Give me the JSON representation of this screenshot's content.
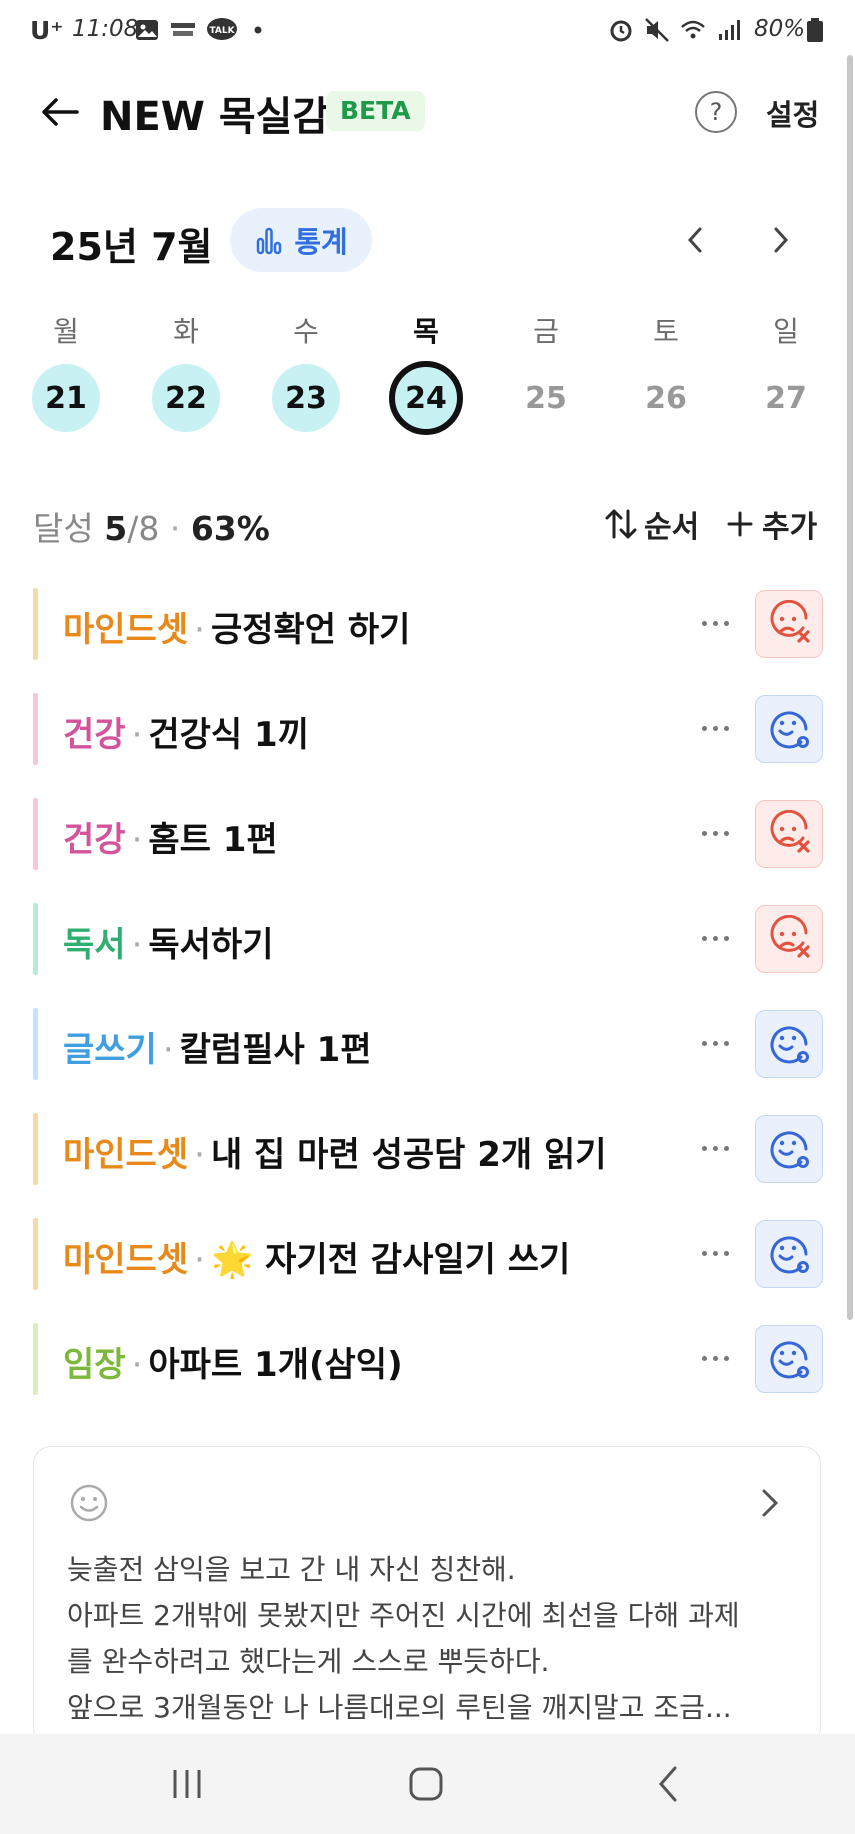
{
  "status_bar": {
    "carrier": "U⁺",
    "time": "11:08",
    "battery": "80%"
  },
  "header": {
    "title": "NEW 목실감",
    "badge": "BETA",
    "help_label": "?",
    "settings_label": "설정"
  },
  "calendar": {
    "month": "25년 7월",
    "stats_label": "통계",
    "weekdays": [
      "월",
      "화",
      "수",
      "목",
      "금",
      "토",
      "일"
    ],
    "days": [
      {
        "num": "21",
        "state": "done"
      },
      {
        "num": "22",
        "state": "done"
      },
      {
        "num": "23",
        "state": "done"
      },
      {
        "num": "24",
        "state": "selected"
      },
      {
        "num": "25",
        "state": "future"
      },
      {
        "num": "26",
        "state": "future"
      },
      {
        "num": "27",
        "state": "future"
      }
    ]
  },
  "summary": {
    "label": "달성",
    "done": "5",
    "total": "/8",
    "dot": "·",
    "percent": "63%",
    "order_label": "순서",
    "add_label": "추가"
  },
  "habits": [
    {
      "category": "마인드셋",
      "name": "긍정확언 하기",
      "status": "fail",
      "color": "#e8891a",
      "bar": "#f9d8a8"
    },
    {
      "category": "건강",
      "name": "건강식 1끼",
      "status": "ok",
      "color": "#d4549c",
      "bar": "#f6c6e0"
    },
    {
      "category": "건강",
      "name": "홈트 1편",
      "status": "fail",
      "color": "#d4549c",
      "bar": "#f6c6e0"
    },
    {
      "category": "독서",
      "name": "독서하기",
      "status": "fail",
      "color": "#2fae71",
      "bar": "#b6ecd0"
    },
    {
      "category": "글쓰기",
      "name": "칼럼필사 1편",
      "status": "ok",
      "color": "#3f9fe0",
      "bar": "#c3e3fa"
    },
    {
      "category": "마인드셋",
      "name": "내 집 마련 성공담 2개 읽기",
      "status": "ok",
      "color": "#e8891a",
      "bar": "#f9d8a8"
    },
    {
      "category": "마인드셋",
      "name": "🌟 자기전 감사일기 쓰기",
      "status": "ok",
      "color": "#e8891a",
      "bar": "#f9d8a8"
    },
    {
      "category": "임장",
      "name": "아파트 1개(삼익)",
      "status": "ok",
      "color": "#7cb83a",
      "bar": "#d9eeb8"
    }
  ],
  "memo": {
    "lines": [
      "늦출전 삼익을 보고 간 내 자신 칭찬해.",
      "아파트 2개밖에 못봤지만 주어진 시간에 최선을 다해 과제",
      "를 완수하려고 했다는게 스스로 뿌듯하다.",
      "앞으로 3개월동안 나 나름대로의 루틴을 깨지말고 조금..."
    ]
  },
  "colors": {
    "fail": "#e2533f",
    "ok": "#3567d8",
    "accent": "#2f6fe0",
    "beta": "#1f9a4a"
  }
}
